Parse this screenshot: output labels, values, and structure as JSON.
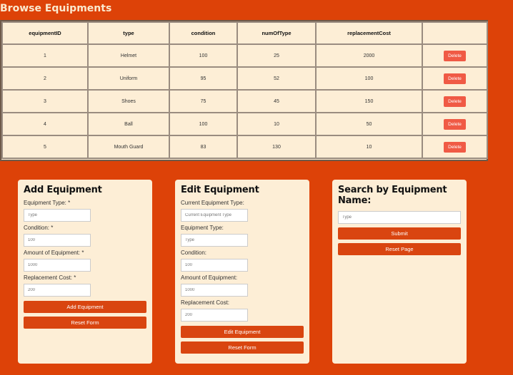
{
  "page": {
    "title": "Browse Equipments"
  },
  "table": {
    "headers": [
      "equipmentID",
      "type",
      "condition",
      "numOfType",
      "replacementCost",
      ""
    ],
    "rows": [
      [
        "1",
        "Helmet",
        "100",
        "25",
        "2000"
      ],
      [
        "2",
        "Uniform",
        "95",
        "52",
        "100"
      ],
      [
        "3",
        "Shoes",
        "75",
        "45",
        "150"
      ],
      [
        "4",
        "Ball",
        "100",
        "10",
        "50"
      ],
      [
        "5",
        "Mouth Guard",
        "83",
        "130",
        "10"
      ]
    ],
    "delete_label": "Delete"
  },
  "add_panel": {
    "title": "Add Equipment",
    "fields": [
      {
        "label": "Equipment Type: *",
        "placeholder": "Type"
      },
      {
        "label": "Condition: *",
        "placeholder": "100"
      },
      {
        "label": "Amount of Equipment: *",
        "placeholder": "1000"
      },
      {
        "label": "Replacement Cost: *",
        "placeholder": "200"
      }
    ],
    "submit_label": "Add Equipment",
    "reset_label": "Reset Form"
  },
  "edit_panel": {
    "title": "Edit Equipment",
    "fields": [
      {
        "label": "Current Equipment Type:",
        "placeholder": "Current Equipment Type"
      },
      {
        "label": "Equipment Type:",
        "placeholder": "Type"
      },
      {
        "label": "Condition:",
        "placeholder": "100"
      },
      {
        "label": "Amount of Equipment:",
        "placeholder": "1000"
      },
      {
        "label": "Replacement Cost:",
        "placeholder": "200"
      }
    ],
    "submit_label": "Edit Equipment",
    "reset_label": "Reset Form"
  },
  "search_panel": {
    "title": "Search by Equipment Name:",
    "placeholder": "Type",
    "submit_label": "Submit",
    "reset_label": "Reset Page"
  },
  "colors": {
    "background": "#dd4208",
    "panel": "#fdeed6",
    "button": "#d94510",
    "delete_button": "#f05a45"
  }
}
